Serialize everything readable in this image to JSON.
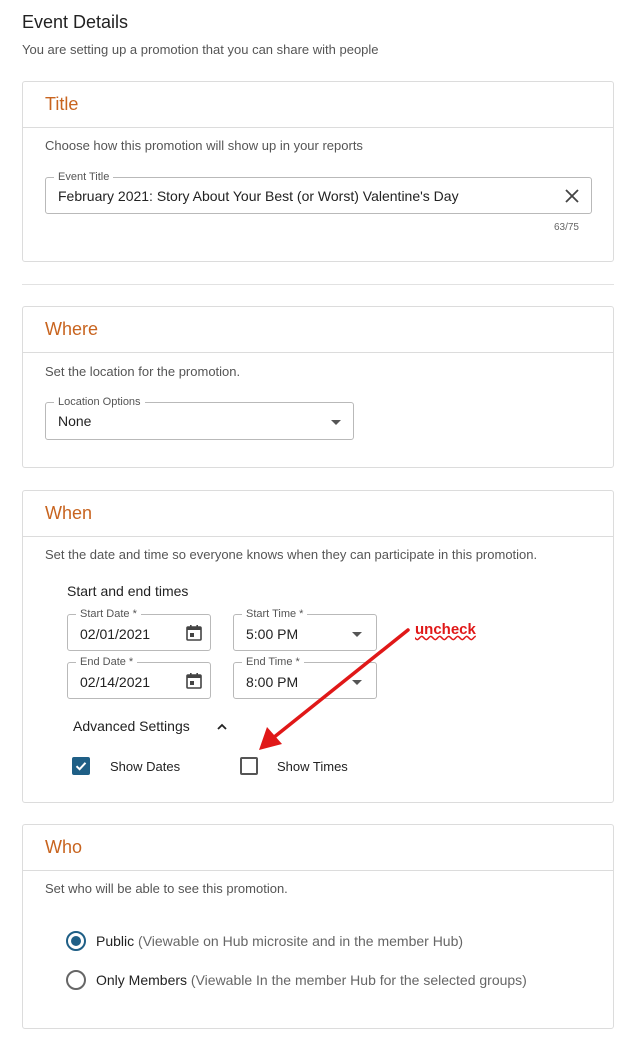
{
  "page": {
    "title": "Event Details",
    "subtitle": "You are setting up a promotion that you can share with people"
  },
  "title_section": {
    "heading": "Title",
    "description": "Choose how this promotion will show up in your reports",
    "field_label": "Event Title",
    "field_value": "February 2021: Story About Your Best (or Worst) Valentine's Day",
    "counter": "63/75",
    "clear_icon": "close-icon"
  },
  "where_section": {
    "heading": "Where",
    "description": "Set the location for the promotion.",
    "field_label": "Location Options",
    "field_value": "None"
  },
  "when_section": {
    "heading": "When",
    "description": "Set the date and time so everyone knows when they can participate in this promotion.",
    "times_label": "Start and end times",
    "start_date_label": "Start Date *",
    "start_date": "02/01/2021",
    "start_time_label": "Start Time *",
    "start_time": "5:00 PM",
    "end_date_label": "End Date *",
    "end_date": "02/14/2021",
    "end_time_label": "End Time *",
    "end_time": "8:00 PM",
    "advanced_label": "Advanced Settings",
    "show_dates_label": "Show Dates",
    "show_dates_checked": true,
    "show_times_label": "Show Times",
    "show_times_checked": false
  },
  "who_section": {
    "heading": "Who",
    "description": "Set who will be able to see this promotion.",
    "options": [
      {
        "label": "Public",
        "hint": "(Viewable on Hub microsite and in the member Hub)",
        "selected": true
      },
      {
        "label": "Only Members",
        "hint": "(Viewable In the member Hub for the selected groups)",
        "selected": false
      }
    ]
  },
  "annotation": {
    "text": "uncheck",
    "color": "#e01818"
  },
  "colors": {
    "accent": "#c8641f",
    "primary": "#1f5f86"
  }
}
